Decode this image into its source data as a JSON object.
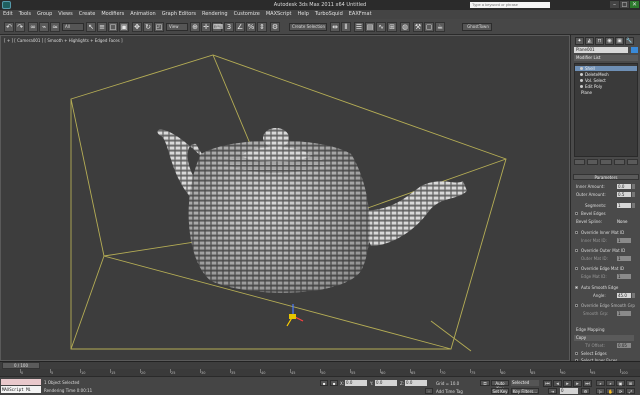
{
  "window": {
    "title": "Autodesk 3ds Max  2011 x64     Untitled",
    "search_placeholder": "Type a keyword or phrase",
    "minimize": "–",
    "maximize": "□",
    "close": "✕"
  },
  "menu": [
    "Edit",
    "Tools",
    "Group",
    "Views",
    "Create",
    "Modifiers",
    "Animation",
    "Graph Editors",
    "Rendering",
    "Customize",
    "MAXScript",
    "Help",
    "TurboSquid",
    "EAXFmat"
  ],
  "toolbar": {
    "selection_filter": "All",
    "reference_coord": "View",
    "named_selection": "Create Selection S",
    "ghost_label": "GhostTown"
  },
  "viewport": {
    "label": "[ + ] [ Camera001 ] [ Smooth + Highlights + Edged Faces ]"
  },
  "command_panel": {
    "tabs": [
      "✦",
      "◭",
      "⊓",
      "◉",
      "▣",
      "🔧"
    ],
    "object_name": "Plane001",
    "modifier_list": "Modifier List",
    "stack": [
      "Shell",
      "DeleteMesh",
      "Vol. Select",
      "Edit Poly",
      "Plane"
    ],
    "parameters_title": "Parameters",
    "inner_amount_label": "Inner Amount:",
    "inner_amount": "0.0",
    "outer_amount_label": "Outer Amount:",
    "outer_amount": "0.5",
    "segments_label": "Segments:",
    "segments": "1",
    "bevel_edges": "Bevel Edges",
    "bevel_spline_label": "Bevel Spline:",
    "bevel_spline": "None",
    "override_inner": "Override Inner Mat ID",
    "inner_mat_id_label": "Inner Mat ID:",
    "inner_mat_id": "1",
    "override_outer": "Override Outer Mat ID",
    "outer_mat_id_label": "Outer Mat ID:",
    "outer_mat_id": "1",
    "override_edge": "Override Edge Mat ID",
    "edge_mat_id_label": "Edge Mat ID:",
    "edge_mat_id": "1",
    "auto_smooth": "Auto Smooth Edge",
    "angle_label": "Angle:",
    "angle": "45.0",
    "override_edge_smooth": "Override Edge Smooth Grp",
    "smooth_grp_label": "Smooth Grp:",
    "smooth_grp": "1",
    "edge_mapping_label": "Edge Mapping",
    "edge_mapping": "Copy",
    "tv_offset_label": "TV Offset:",
    "tv_offset": "0.05",
    "select_edges": "Select Edges",
    "select_inner": "Select Inner Faces"
  },
  "timeline": {
    "frame": "0 / 100",
    "ticks": [
      "0",
      "5",
      "10",
      "15",
      "20",
      "25",
      "30",
      "35",
      "40",
      "45",
      "50",
      "55",
      "60",
      "65",
      "70",
      "75",
      "80",
      "85",
      "90",
      "95",
      "100"
    ]
  },
  "status": {
    "maxscript_label": "MAXScript Mi",
    "selection_info": "1 Object Selected",
    "render_info": "Rendering Time  0:00:11",
    "x_label": "X:",
    "x_value": "0.0",
    "y_label": "Y:",
    "y_value": "0.0",
    "z_label": "Z:",
    "z_value": "0.0",
    "grid": "Grid = 10.0",
    "add_time_tag": "Add Time Tag",
    "auto_key": "Auto Key",
    "set_key": "Set Key",
    "key_mode": "Selected",
    "key_filters": "Key Filters...",
    "current_frame": "0"
  }
}
